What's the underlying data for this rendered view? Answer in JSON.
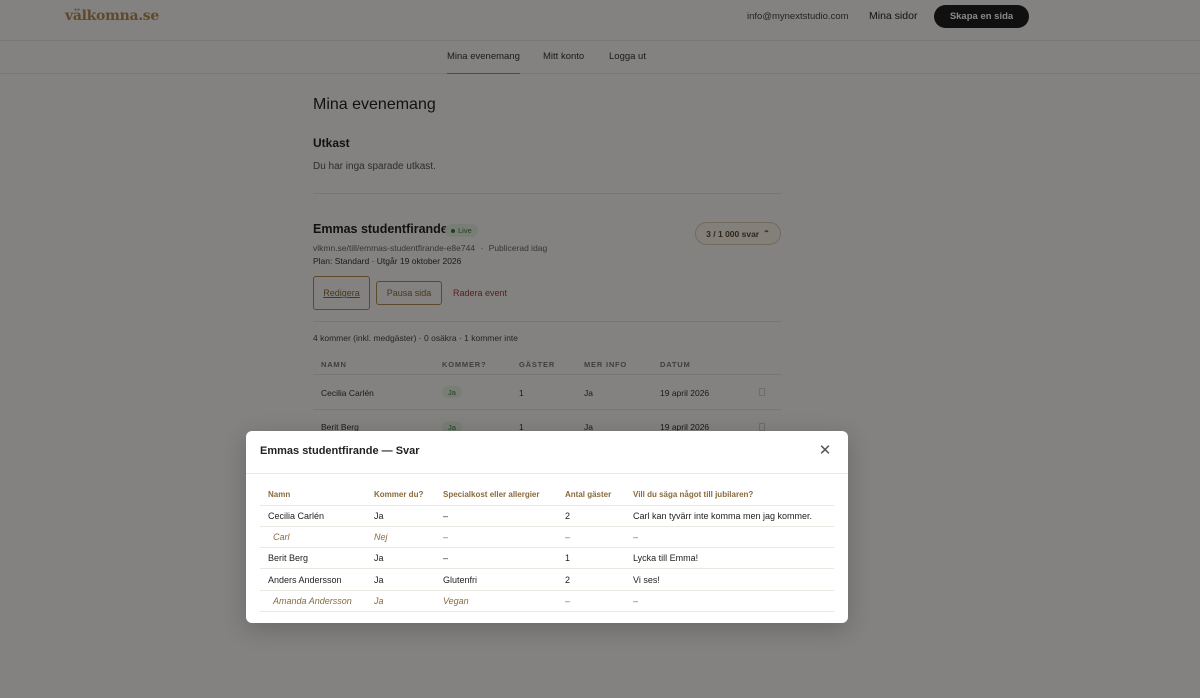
{
  "header": {
    "logo": "välkomna.se",
    "email": "info@mynextstudio.com",
    "mina_sidor": "Mina sidor",
    "create_button": "Skapa en sida"
  },
  "subnav": {
    "tabs": [
      {
        "label": "Mina evenemang",
        "active": true
      },
      {
        "label": "Mitt konto",
        "active": false
      },
      {
        "label": "Logga ut",
        "active": false
      }
    ]
  },
  "page": {
    "title": "Mina evenemang",
    "drafts_title": "Utkast",
    "drafts_text": "Du har inga sparade utkast."
  },
  "event": {
    "title": "Emmas studentfirande",
    "status": "Live",
    "url": "vlkmn.se/till/emmas-studentfirande-e8e744",
    "published": "Publicerad idag",
    "url_separator": "·",
    "plan": "Plan: Standard · Utgår 19 oktober 2026",
    "responses_pill": "3 / 1 000 svar",
    "buttons": {
      "edit": "Redigera",
      "pause": "Pausa sida",
      "delete": "Radera event"
    },
    "summary": "4 kommer (inkl. medgäster) · 0 osäkra · 1 kommer inte",
    "table": {
      "headers": [
        "NAMN",
        "KOMMER?",
        "GÄSTER",
        "MER INFO",
        "DATUM"
      ],
      "rows": [
        {
          "name": "Cecilia Carlén",
          "coming": "Ja",
          "guests": "1",
          "info": "Ja",
          "date": "19 april 2026"
        },
        {
          "name": "Berit Berg",
          "coming": "Ja",
          "guests": "1",
          "info": "Ja",
          "date": "19 april 2026"
        }
      ]
    }
  },
  "modal": {
    "title": "Emmas studentfirande — Svar",
    "headers": [
      "Namn",
      "Kommer du?",
      "Specialkost eller allergier",
      "Antal gäster",
      "Vill du säga något till jubilaren?"
    ],
    "rows": [
      {
        "name": "Cecilia Carlén",
        "coming": "Ja",
        "diet": "–",
        "guests": "2",
        "message": "Carl kan tyvärr inte komma men jag kommer.",
        "guest_row": false
      },
      {
        "name": "Carl",
        "coming": "Nej",
        "diet": "–",
        "guests": "–",
        "message": "–",
        "guest_row": true
      },
      {
        "name": "Berit Berg",
        "coming": "Ja",
        "diet": "–",
        "guests": "1",
        "message": "Lycka till Emma!",
        "guest_row": false
      },
      {
        "name": "Anders Andersson",
        "coming": "Ja",
        "diet": "Glutenfri",
        "guests": "2",
        "message": "Vi ses!",
        "guest_row": false
      },
      {
        "name": "Amanda Andersson",
        "coming": "Ja",
        "diet": "Vegan",
        "guests": "–",
        "message": "–",
        "guest_row": true
      }
    ]
  },
  "colors": {
    "accent": "#b08a52",
    "live_green": "#3e7a36",
    "danger": "#a63d2f"
  }
}
